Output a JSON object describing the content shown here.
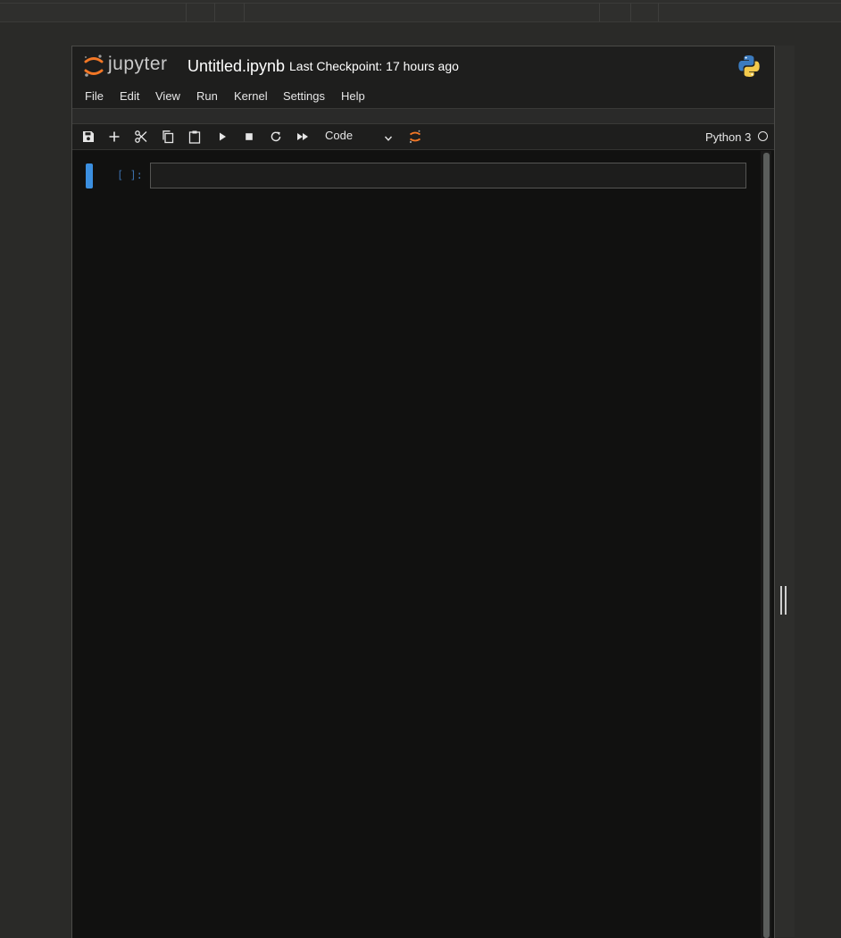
{
  "header": {
    "logo_text": "jupyter",
    "notebook_title": "Untitled.ipynb",
    "checkpoint": "Last Checkpoint: 17 hours ago"
  },
  "menu": {
    "items": [
      "File",
      "Edit",
      "View",
      "Run",
      "Kernel",
      "Settings",
      "Help"
    ]
  },
  "toolbar": {
    "icons": [
      "save-icon",
      "add-icon",
      "cut-icon",
      "copy-icon",
      "paste-icon",
      "run-icon",
      "stop-icon",
      "restart-icon",
      "fast-forward-icon",
      "jupyter-icon"
    ],
    "cell_type": "Code",
    "kernel_name": "Python 3",
    "kernel_status": "idle"
  },
  "cell": {
    "prompt": "[ ]:",
    "value": ""
  },
  "colors": {
    "accent": "#3b8fe0",
    "jupyter_orange": "#f37726",
    "background": "#111110"
  }
}
